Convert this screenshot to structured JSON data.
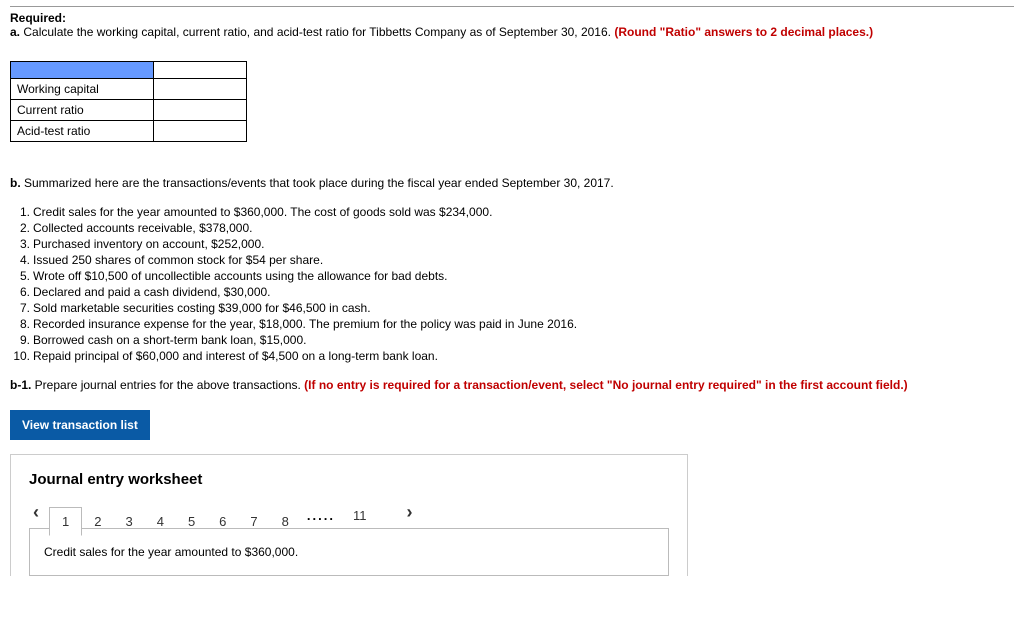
{
  "header": {
    "required_label": "Required:",
    "part_a_prefix": "a.",
    "part_a_text": " Calculate the working capital, current ratio, and acid-test ratio for Tibbetts Company as of September 30, 2016. ",
    "part_a_red": "(Round \"Ratio\" answers to 2 decimal places.)"
  },
  "calc_table": {
    "rows": [
      {
        "label": "Working capital",
        "value": ""
      },
      {
        "label": "Current ratio",
        "value": ""
      },
      {
        "label": "Acid-test ratio",
        "value": ""
      }
    ]
  },
  "part_b": {
    "prefix": "b.",
    "text": " Summarized here are the transactions/events that took place during the fiscal year ended September 30, 2017."
  },
  "transactions": [
    "Credit sales for the year amounted to $360,000. The cost of goods sold was $234,000.",
    "Collected accounts receivable, $378,000.",
    "Purchased inventory on account, $252,000.",
    "Issued 250 shares of common stock for $54 per share.",
    "Wrote off $10,500 of uncollectible accounts using the allowance for bad debts.",
    "Declared and paid a cash dividend, $30,000.",
    "Sold marketable securities costing $39,000 for $46,500 in cash.",
    "Recorded insurance expense for the year, $18,000. The premium for the policy was paid in June 2016.",
    "Borrowed cash on a short-term bank loan, $15,000.",
    "Repaid principal of $60,000 and interest of $4,500 on a long-term bank loan."
  ],
  "part_b1": {
    "prefix": "b-1.",
    "text": " Prepare journal entries for the above transactions. ",
    "red": "(If no entry is required for a transaction/event, select \"No journal entry required\" in the first account field.)"
  },
  "view_button": "View transaction list",
  "worksheet": {
    "title": "Journal entry worksheet",
    "tabs": [
      "1",
      "2",
      "3",
      "4",
      "5",
      "6",
      "7",
      "8"
    ],
    "dots": ".....",
    "last_tab": "11",
    "active_tab_index": 0,
    "entry_text": "Credit sales for the year amounted to $360,000."
  }
}
